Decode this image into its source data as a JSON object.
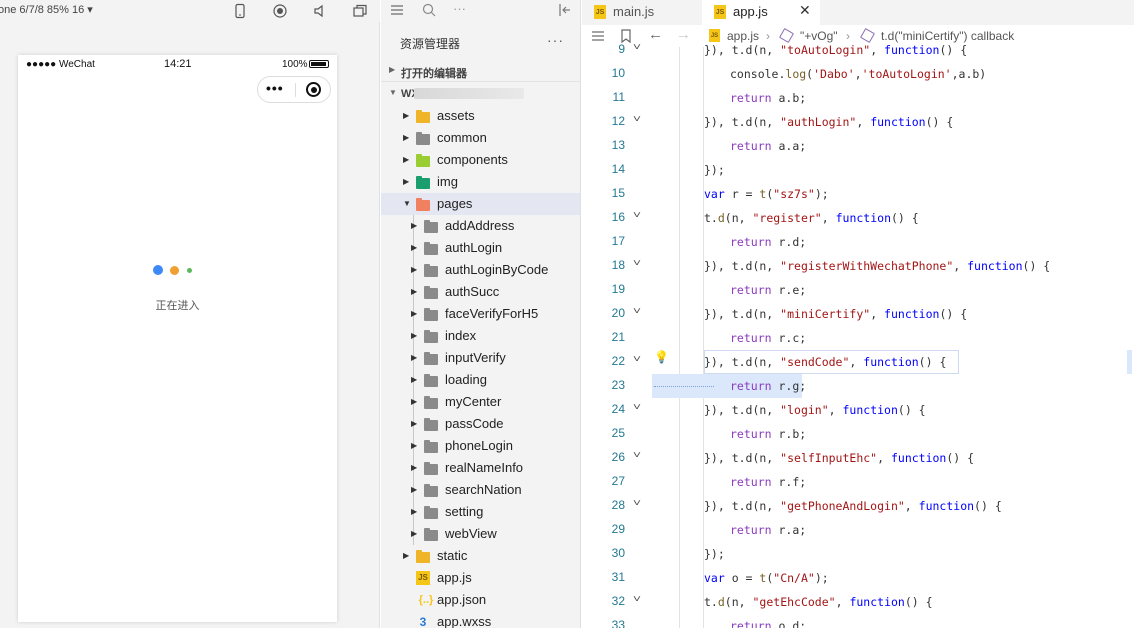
{
  "simulator": {
    "device_label": "one 6/7/8 85% 16 ▾",
    "status": {
      "carrier": "●●●●● WeChat",
      "time": "14:21",
      "battery": "100%"
    },
    "capsule": {
      "more": "•••"
    },
    "loading_text": "正在进入",
    "loading_dot_colors": [
      "#3d8af7",
      "#f0a030",
      "#5cb85c"
    ]
  },
  "explorer": {
    "title": "资源管理器",
    "menu": "···",
    "section_open": "打开的编辑器",
    "section_project": "WX1",
    "tree": [
      {
        "name": "assets",
        "kind": "folder",
        "color": "#f0b429",
        "depth": 0,
        "expanded": false
      },
      {
        "name": "common",
        "kind": "folder",
        "color": "#8a8a8a",
        "depth": 0,
        "expanded": false
      },
      {
        "name": "components",
        "kind": "folder",
        "color": "#9acd32",
        "depth": 0,
        "expanded": false
      },
      {
        "name": "img",
        "kind": "folder",
        "color": "#1a9e6e",
        "depth": 0,
        "expanded": false
      },
      {
        "name": "pages",
        "kind": "folder",
        "color": "#f08060",
        "depth": 0,
        "expanded": true,
        "selected": true
      },
      {
        "name": "addAddress",
        "kind": "folder",
        "color": "#8a8a8a",
        "depth": 1
      },
      {
        "name": "authLogin",
        "kind": "folder",
        "color": "#8a8a8a",
        "depth": 1
      },
      {
        "name": "authLoginByCode",
        "kind": "folder",
        "color": "#8a8a8a",
        "depth": 1
      },
      {
        "name": "authSucc",
        "kind": "folder",
        "color": "#8a8a8a",
        "depth": 1
      },
      {
        "name": "faceVerifyForH5",
        "kind": "folder",
        "color": "#8a8a8a",
        "depth": 1
      },
      {
        "name": "index",
        "kind": "folder",
        "color": "#8a8a8a",
        "depth": 1
      },
      {
        "name": "inputVerify",
        "kind": "folder",
        "color": "#8a8a8a",
        "depth": 1
      },
      {
        "name": "loading",
        "kind": "folder",
        "color": "#8a8a8a",
        "depth": 1
      },
      {
        "name": "myCenter",
        "kind": "folder",
        "color": "#8a8a8a",
        "depth": 1
      },
      {
        "name": "passCode",
        "kind": "folder",
        "color": "#8a8a8a",
        "depth": 1
      },
      {
        "name": "phoneLogin",
        "kind": "folder",
        "color": "#8a8a8a",
        "depth": 1
      },
      {
        "name": "realNameInfo",
        "kind": "folder",
        "color": "#8a8a8a",
        "depth": 1
      },
      {
        "name": "searchNation",
        "kind": "folder",
        "color": "#8a8a8a",
        "depth": 1
      },
      {
        "name": "setting",
        "kind": "folder",
        "color": "#8a8a8a",
        "depth": 1
      },
      {
        "name": "webView",
        "kind": "folder",
        "color": "#8a8a8a",
        "depth": 1
      },
      {
        "name": "static",
        "kind": "folder",
        "color": "#f0b429",
        "depth": 0,
        "expanded": false
      },
      {
        "name": "app.js",
        "kind": "js",
        "color": "#f5c518",
        "depth": 0
      },
      {
        "name": "app.json",
        "kind": "json",
        "color": "#f5c518",
        "depth": 0
      },
      {
        "name": "app.wxss",
        "kind": "css",
        "color": "#2a7bd4",
        "depth": 0
      }
    ]
  },
  "editor": {
    "tabs": [
      {
        "label": "main.js",
        "icon": "JS",
        "active": false
      },
      {
        "label": "app.js",
        "icon": "JS",
        "active": true,
        "close": "✕"
      }
    ],
    "breadcrumb": [
      "app.js",
      "\"+vOg\"",
      "t.d(\"miniCertify\") callback"
    ],
    "lines": [
      {
        "num": "9",
        "fold": true,
        "indent": 1,
        "html": "<span>}), t.d(n, </span><span class=\"s\">\"toAutoLogin\"</span><span>, </span><span class=\"k\">function</span><span>() {</span>"
      },
      {
        "num": "10",
        "fold": false,
        "indent": 2,
        "html": "<span>console.</span><span class=\"f\">log</span><span>(</span><span class=\"s\">'Dabo'</span><span>,</span><span class=\"s\">'toAutoLogin'</span><span>,a.b)</span>"
      },
      {
        "num": "11",
        "fold": false,
        "indent": 2,
        "html": "<span class=\"p\">return</span><span> a.b;</span>"
      },
      {
        "num": "12",
        "fold": true,
        "indent": 1,
        "html": "<span>}), t.d(n, </span><span class=\"s\">\"authLogin\"</span><span>, </span><span class=\"k\">function</span><span>() {</span>"
      },
      {
        "num": "13",
        "fold": false,
        "indent": 2,
        "html": "<span class=\"p\">return</span><span> a.a;</span>"
      },
      {
        "num": "14",
        "fold": false,
        "indent": 1,
        "html": "<span>});</span>"
      },
      {
        "num": "15",
        "fold": false,
        "indent": 1,
        "html": "<span class=\"k\">var</span><span> r = </span><span class=\"f\">t</span><span>(</span><span class=\"s\">\"sz7s\"</span><span>);</span>"
      },
      {
        "num": "16",
        "fold": true,
        "indent": 1,
        "html": "<span>t.</span><span class=\"f\">d</span><span>(n, </span><span class=\"s\">\"register\"</span><span>, </span><span class=\"k\">function</span><span>() {</span>"
      },
      {
        "num": "17",
        "fold": false,
        "indent": 2,
        "html": "<span class=\"p\">return</span><span> r.d;</span>"
      },
      {
        "num": "18",
        "fold": true,
        "indent": 1,
        "html": "<span>}), t.d(n, </span><span class=\"s\">\"registerWithWechatPhone\"</span><span>, </span><span class=\"k\">function</span><span>() {</span>"
      },
      {
        "num": "19",
        "fold": false,
        "indent": 2,
        "html": "<span class=\"p\">return</span><span> r.e;</span>"
      },
      {
        "num": "20",
        "fold": true,
        "indent": 1,
        "html": "<span>}), t.d(n, </span><span class=\"s\">\"miniCertify\"</span><span>, </span><span class=\"k\">function</span><span>() {</span>"
      },
      {
        "num": "21",
        "fold": false,
        "indent": 2,
        "html": "<span class=\"p\">return</span><span> r.c;</span>"
      },
      {
        "num": "22",
        "fold": true,
        "indent": 1,
        "html": "<span>}), t.d(n, </span><span class=\"s\">\"sendCode\"</span><span>, </span><span class=\"k\">function</span><span>() {</span>"
      },
      {
        "num": "23",
        "fold": false,
        "indent": 2,
        "html": "<span class=\"p\">return</span><span> r.g;</span>"
      },
      {
        "num": "24",
        "fold": true,
        "indent": 1,
        "html": "<span>}), t.d(n, </span><span class=\"s\">\"login\"</span><span>, </span><span class=\"k\">function</span><span>() {</span>"
      },
      {
        "num": "25",
        "fold": false,
        "indent": 2,
        "html": "<span class=\"p\">return</span><span> r.b;</span>"
      },
      {
        "num": "26",
        "fold": true,
        "indent": 1,
        "html": "<span>}), t.d(n, </span><span class=\"s\">\"selfInputEhc\"</span><span>, </span><span class=\"k\">function</span><span>() {</span>"
      },
      {
        "num": "27",
        "fold": false,
        "indent": 2,
        "html": "<span class=\"p\">return</span><span> r.f;</span>"
      },
      {
        "num": "28",
        "fold": true,
        "indent": 1,
        "html": "<span>}), t.d(n, </span><span class=\"s\">\"getPhoneAndLogin\"</span><span>, </span><span class=\"k\">function</span><span>() {</span>"
      },
      {
        "num": "29",
        "fold": false,
        "indent": 2,
        "html": "<span class=\"p\">return</span><span> r.a;</span>"
      },
      {
        "num": "30",
        "fold": false,
        "indent": 1,
        "html": "<span>});</span>"
      },
      {
        "num": "31",
        "fold": false,
        "indent": 1,
        "html": "<span class=\"k\">var</span><span> o = </span><span class=\"f\">t</span><span>(</span><span class=\"s\">\"Cn/A\"</span><span>);</span>"
      },
      {
        "num": "32",
        "fold": true,
        "indent": 1,
        "html": "<span>t.</span><span class=\"f\">d</span><span>(n, </span><span class=\"s\">\"getEhcCode\"</span><span>, </span><span class=\"k\">function</span><span>() {</span>"
      },
      {
        "num": "33",
        "fold": false,
        "indent": 2,
        "html": "<span class=\"p\">return</span><span> o.d;</span>"
      }
    ]
  }
}
